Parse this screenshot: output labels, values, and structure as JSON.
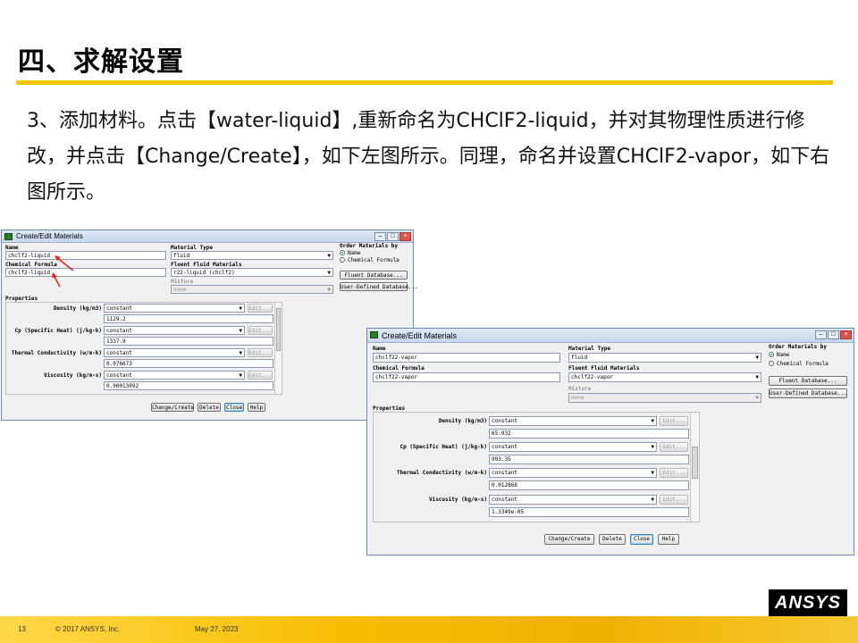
{
  "slide": {
    "title": "四、求解设置",
    "paragraph": "3、添加材料。点击【water-liquid】,重新命名为CHClF2-liquid，并对其物理性质进行修改，并点击【Change/Create】，如下左图所示。同理，命名并设置CHClF2-vapor，如下右图所示。",
    "page_number": "13",
    "copyright": "© 2017 ANSYS, Inc.",
    "date": "May 27, 2023",
    "logo": "ANSYS"
  },
  "left_dialog": {
    "title": "Create/Edit Materials",
    "name_label": "Name",
    "name_value": "chclf2-liquid",
    "formula_label": "Chemical Formula",
    "formula_value": "chclf2-liquid",
    "material_type_label": "Material Type",
    "material_type_value": "fluid",
    "fluent_fluid_label": "Fluent Fluid Materials",
    "fluent_fluid_value": "r22-liquid (chclf2)",
    "mixture_label": "Mixture",
    "mixture_value": "none",
    "order_label": "Order Materials by",
    "order_options": [
      "Name",
      "Chemical Formula"
    ],
    "fluent_db_button": "Fluent Database...",
    "user_db_button": "User-Defined Database...",
    "properties_label": "Properties",
    "properties": [
      {
        "label": "Density (kg/m3)",
        "method": "constant",
        "edit": "Edit...",
        "value": "1129.2"
      },
      {
        "label": "Cp (Specific Heat) (j/kg-k)",
        "method": "constant",
        "edit": "Edit...",
        "value": "1337.9"
      },
      {
        "label": "Thermal Conductivity (w/m-k)",
        "method": "constant",
        "edit": "Edit...",
        "value": "0.076673"
      },
      {
        "label": "Viscosity (kg/m-s)",
        "method": "constant",
        "edit": "Edit...",
        "value": "0.00013092"
      }
    ],
    "buttons": [
      "Change/Create",
      "Delete",
      "Close",
      "Help"
    ]
  },
  "right_dialog": {
    "title": "Create/Edit Materials",
    "name_label": "Name",
    "name_value": "chclf22-vapor",
    "formula_label": "Chemical Formula",
    "formula_value": "chclf22-vapor",
    "material_type_label": "Material Type",
    "material_type_value": "fluid",
    "fluent_fluid_label": "Fluent Fluid Materials",
    "fluent_fluid_value": "chclf22-vapor",
    "mixture_label": "Mixture",
    "mixture_value": "none",
    "order_label": "Order Materials by",
    "order_options": [
      "Name",
      "Chemical Formula"
    ],
    "fluent_db_button": "Fluent Database...",
    "user_db_button": "User-Defined Database...",
    "properties_label": "Properties",
    "properties": [
      {
        "label": "Density (kg/m3)",
        "method": "constant",
        "edit": "Edit...",
        "value": "65.932"
      },
      {
        "label": "Cp (Specific Heat) (j/kg-k)",
        "method": "constant",
        "edit": "Edit...",
        "value": "993.35"
      },
      {
        "label": "Thermal Conductivity (w/m-k)",
        "method": "constant",
        "edit": "Edit...",
        "value": "0.012868"
      },
      {
        "label": "Viscosity (kg/m-s)",
        "method": "constant",
        "edit": "Edit...",
        "value": "1.3349e-05"
      }
    ],
    "buttons": [
      "Change/Create",
      "Delete",
      "Close",
      "Help"
    ]
  },
  "colors": {
    "accent_yellow": "#f5c400",
    "annotation_red": "#e02020"
  }
}
